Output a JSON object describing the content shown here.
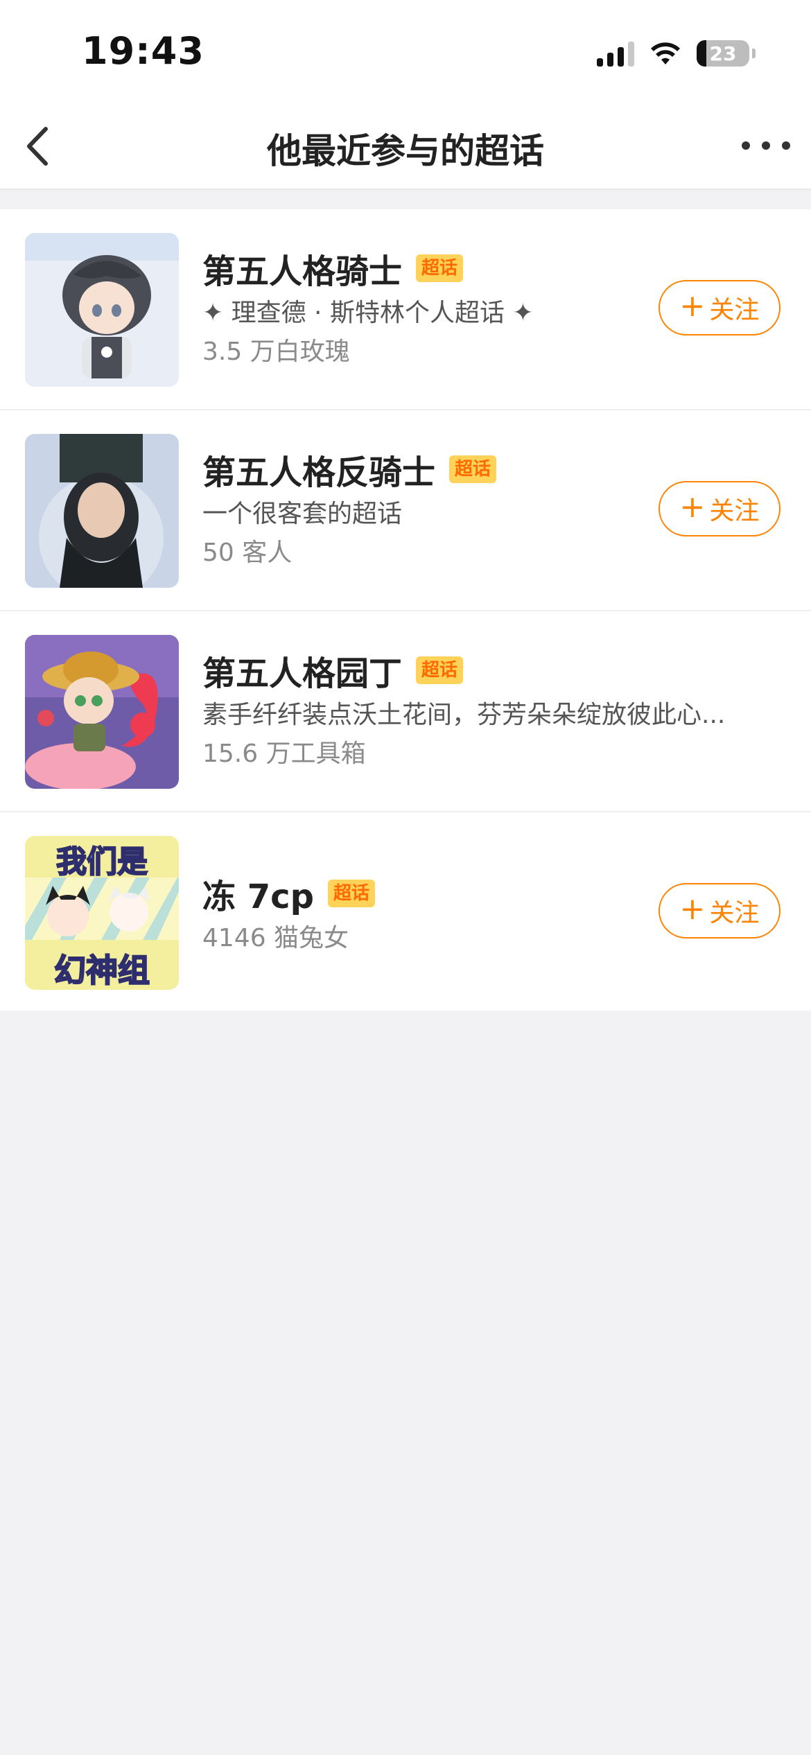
{
  "status_bar": {
    "time": "19:43",
    "battery": "23"
  },
  "nav": {
    "title": "他最近参与的超话"
  },
  "topics": [
    {
      "title": "第五人格骑士",
      "badge": "超话",
      "desc": "✦ 理查德 · 斯特林个人超话 ✦",
      "stats": "3.5 万白玫瑰",
      "follow": "关注",
      "show_follow": true
    },
    {
      "title": "第五人格反骑士",
      "badge": "超话",
      "desc": "一个很客套的超话",
      "stats": "50 客人",
      "follow": "关注",
      "show_follow": true
    },
    {
      "title": "第五人格园丁",
      "badge": "超话",
      "desc": "素手纤纤装点沃土花间，芬芳朵朵绽放彼此心...",
      "stats": "15.6 万工具箱",
      "show_follow": false
    },
    {
      "title": "冻 7cp",
      "badge": "超话",
      "desc": "",
      "stats": "4146 猫兔女",
      "follow": "关注",
      "show_follow": true
    }
  ],
  "thumb_art_text": [
    "我们是",
    "幻神组"
  ],
  "colors": {
    "accent": "#ff8200",
    "badge_bg": "#ffd25a",
    "badge_fg": "#ff6a00"
  }
}
